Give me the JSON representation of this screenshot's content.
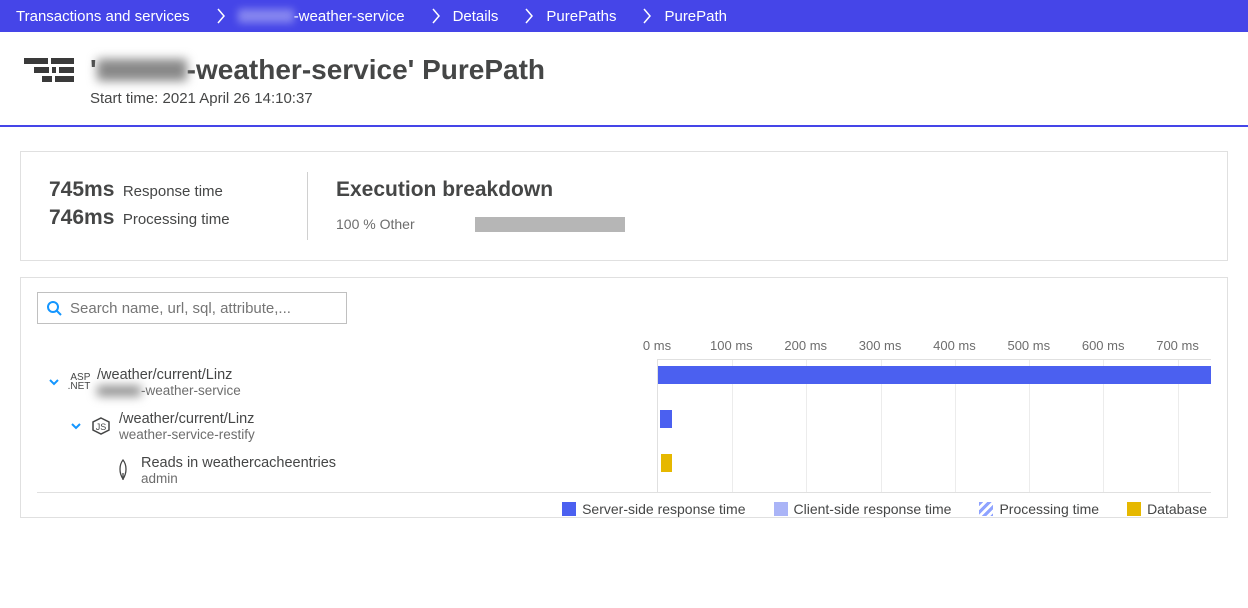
{
  "breadcrumb": [
    {
      "label": "Transactions and services"
    },
    {
      "label_prefix_blurred": true,
      "label_suffix": "-weather-service"
    },
    {
      "label": "Details"
    },
    {
      "label": "PurePaths"
    },
    {
      "label": "PurePath"
    }
  ],
  "header": {
    "title_prefix": "'",
    "title_blurred": true,
    "title_suffix": "-weather-service' PurePath",
    "subtitle": "Start time: 2021 April 26 14:10:37"
  },
  "summary": {
    "response_time_value": "745ms",
    "response_time_label": "Response time",
    "processing_time_value": "746ms",
    "processing_time_label": "Processing time",
    "breakdown_title": "Execution breakdown",
    "breakdown_other_label": "100 % Other"
  },
  "search": {
    "placeholder": "Search name, url, sql, attribute,..."
  },
  "timeline": {
    "max_ms": 745,
    "ticks": [
      "0 ms",
      "100 ms",
      "200 ms",
      "300 ms",
      "400 ms",
      "500 ms",
      "600 ms",
      "700 ms"
    ],
    "tick_values_ms": [
      0,
      100,
      200,
      300,
      400,
      500,
      600,
      700
    ]
  },
  "rows": [
    {
      "indent": 0,
      "expandable": true,
      "tech": "aspnet",
      "primary": "/weather/current/Linz",
      "secondary_blurred": true,
      "secondary_suffix": "-weather-service",
      "bar_start_ms": 0,
      "bar_width_ms": 745,
      "bar_color": "#4b60f0"
    },
    {
      "indent": 1,
      "expandable": true,
      "tech": "nodejs",
      "primary": "/weather/current/Linz",
      "secondary": "weather-service-restify",
      "bar_start_ms": 3,
      "bar_width_ms": 16,
      "bar_color": "#4b60f0"
    },
    {
      "indent": 2,
      "expandable": false,
      "tech": "mongodb",
      "primary": "Reads in weathercacheentries",
      "secondary": "admin",
      "bar_start_ms": 4,
      "bar_width_ms": 15,
      "bar_color": "#e6b800"
    }
  ],
  "legend": {
    "server": "Server-side response time",
    "client": "Client-side response time",
    "processing": "Processing time",
    "database": "Database"
  },
  "colors": {
    "server": "#4b60f0",
    "client": "#aab4f7",
    "database": "#e6b800"
  }
}
